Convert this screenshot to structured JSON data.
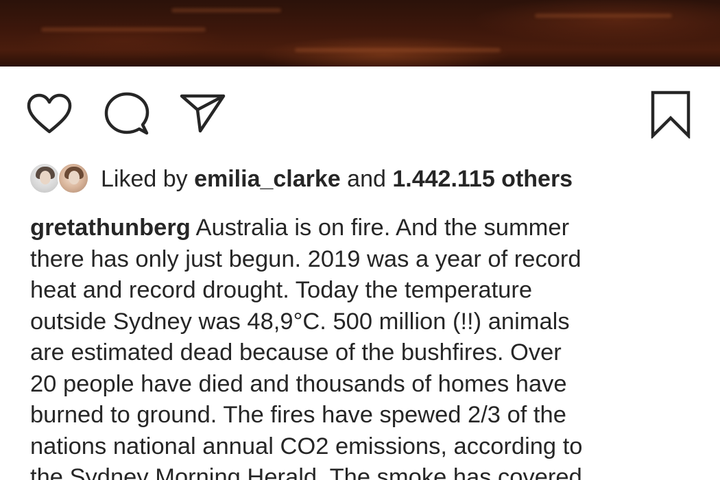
{
  "post": {
    "image": {
      "description_icon": "photo-placeholder"
    },
    "actions": {
      "like": {
        "icon": "heart-outline-icon"
      },
      "comment": {
        "icon": "speech-bubble-icon"
      },
      "share": {
        "icon": "paper-plane-icon"
      },
      "save": {
        "icon": "bookmark-outline-icon"
      }
    },
    "likes": {
      "prefix": "Liked by",
      "first_user": "emilia_clarke",
      "connector": "and",
      "others_count": "1.442.115 others"
    },
    "caption": {
      "username": "gretathunberg",
      "text": " Australia is on fire. And the summer\nthere has only just begun. 2019 was a year of record\nheat and record drought. Today the temperature\noutside Sydney was 48,9°C. 500 million (!!) animals\nare estimated dead because of the bushfires. Over\n20 people have died and thousands of homes have\nburned to ground. The fires have spewed 2/3 of the\nnations national annual CO2 emissions, according to\nthe Sydney Morning Herald. The smoke has covered"
    },
    "colors": {
      "text": "#262626",
      "background": "#ffffff"
    }
  }
}
